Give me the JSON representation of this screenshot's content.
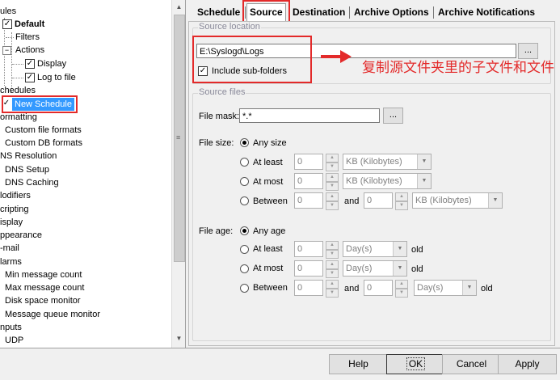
{
  "tree": {
    "items": [
      {
        "label": "ules",
        "level": 0
      },
      {
        "label": "Default",
        "level": 1,
        "checked": true,
        "bold": true
      },
      {
        "label": "Filters",
        "level": 2
      },
      {
        "label": "Actions",
        "level": 2,
        "expanded": true
      },
      {
        "label": "Display",
        "level": 3,
        "checked": true
      },
      {
        "label": "Log to file",
        "level": 3,
        "checked": true
      },
      {
        "label": "chedules",
        "level": 0
      },
      {
        "label": "New Schedule",
        "level": 1,
        "checked": true,
        "selected": true
      },
      {
        "label": "ormatting",
        "level": 0
      },
      {
        "label": "Custom file formats",
        "level": 1
      },
      {
        "label": "Custom DB formats",
        "level": 1
      },
      {
        "label": "NS Resolution",
        "level": 0
      },
      {
        "label": "DNS Setup",
        "level": 1
      },
      {
        "label": "DNS Caching",
        "level": 1
      },
      {
        "label": "lodifiers",
        "level": 0
      },
      {
        "label": "cripting",
        "level": 0
      },
      {
        "label": "isplay",
        "level": 0
      },
      {
        "label": "ppearance",
        "level": 0
      },
      {
        "label": "-mail",
        "level": 0
      },
      {
        "label": "larms",
        "level": 0
      },
      {
        "label": "Min message count",
        "level": 1
      },
      {
        "label": "Max message count",
        "level": 1
      },
      {
        "label": "Disk space monitor",
        "level": 1
      },
      {
        "label": "Message queue monitor",
        "level": 1
      },
      {
        "label": "nputs",
        "level": 0
      },
      {
        "label": "UDP",
        "level": 1
      }
    ]
  },
  "tabs": [
    {
      "label": "Schedule",
      "active": false
    },
    {
      "label": "Source",
      "active": true
    },
    {
      "label": "Destination",
      "active": false
    },
    {
      "label": "Archive Options",
      "active": false
    },
    {
      "label": "Archive Notifications",
      "active": false
    }
  ],
  "source_location": {
    "group_title": "Source location",
    "path_value": "E:\\Syslogd\\Logs",
    "browse_label": "...",
    "include_subfolders_label": "Include sub-folders",
    "include_subfolders_checked": true
  },
  "source_files": {
    "group_title": "Source files",
    "file_mask_label": "File mask:",
    "file_mask_value": "*.*",
    "browse_label": "...",
    "file_size": {
      "label": "File size:",
      "any_label": "Any size",
      "at_least_label": "At least",
      "at_most_label": "At most",
      "between_label": "Between",
      "and_label": "and",
      "selected": "any",
      "at_least_value": "0",
      "at_most_value": "0",
      "between_from": "0",
      "between_to": "0",
      "unit": "KB (Kilobytes)"
    },
    "file_age": {
      "label": "File age:",
      "any_label": "Any age",
      "at_least_label": "At least",
      "at_most_label": "At most",
      "between_label": "Between",
      "and_label": "and",
      "old_label": "old",
      "selected": "any",
      "at_least_value": "0",
      "at_most_value": "0",
      "between_from": "0",
      "between_to": "0",
      "unit": "Day(s)"
    }
  },
  "annotation": {
    "text": "复制源文件夹里的子文件和文件",
    "color": "#e32a2a"
  },
  "buttons": {
    "help": "Help",
    "ok": "OK",
    "cancel": "Cancel",
    "apply": "Apply"
  },
  "colors": {
    "selection": "#3399ff",
    "annotation": "#e32a2a"
  }
}
